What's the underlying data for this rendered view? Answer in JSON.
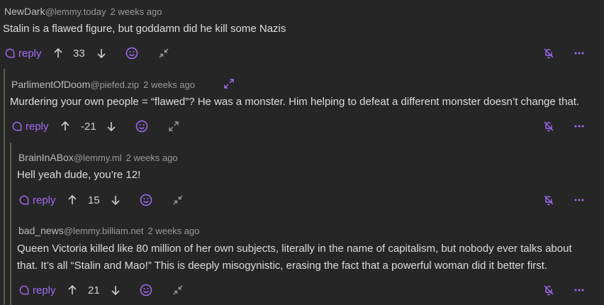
{
  "colors": {
    "accent": "#a36bf5",
    "background": "#262626",
    "thread_line": "#56613a"
  },
  "comments": [
    {
      "user": "NewDark",
      "instance": "@lemmy.today",
      "time": "2 weeks ago",
      "text": "Stalin is a flawed figure, but goddamn did he kill some Nazis",
      "reply_label": "reply",
      "score": "33"
    },
    {
      "user": "ParlimentOfDoom",
      "instance": "@piefed.zip",
      "time": "2 weeks ago",
      "text": "Murdering your own people = “flawed”? He was a monster. Him helping to defeat a different monster doesn’t change that.",
      "reply_label": "reply",
      "score": "-21"
    },
    {
      "user": "BrainInABox",
      "instance": "@lemmy.ml",
      "time": "2 weeks ago",
      "text": "Hell yeah dude, you’re 12!",
      "reply_label": "reply",
      "score": "15"
    },
    {
      "user": "bad_news",
      "instance": "@lemmy.billiam.net",
      "time": "2 weeks ago",
      "text_line1": "Queen Victoria killed like 80 million of her own subjects, literally in the name of capitalism, but nobody ever talks about",
      "text_line2": "that. It’s all “Stalin and Mao!” This is deeply misogynistic, erasing the fact that a powerful woman did it better first.",
      "reply_label": "reply",
      "score": "21"
    }
  ],
  "icons": {
    "reply": "comment-bubble-icon",
    "upvote": "arrow-up-icon",
    "downvote": "arrow-down-icon",
    "emoji": "smiley-icon",
    "collapse": "collapse-arrows-icon",
    "expand": "expand-arrows-icon",
    "mute": "bell-off-icon",
    "more": "more-dots-icon"
  }
}
